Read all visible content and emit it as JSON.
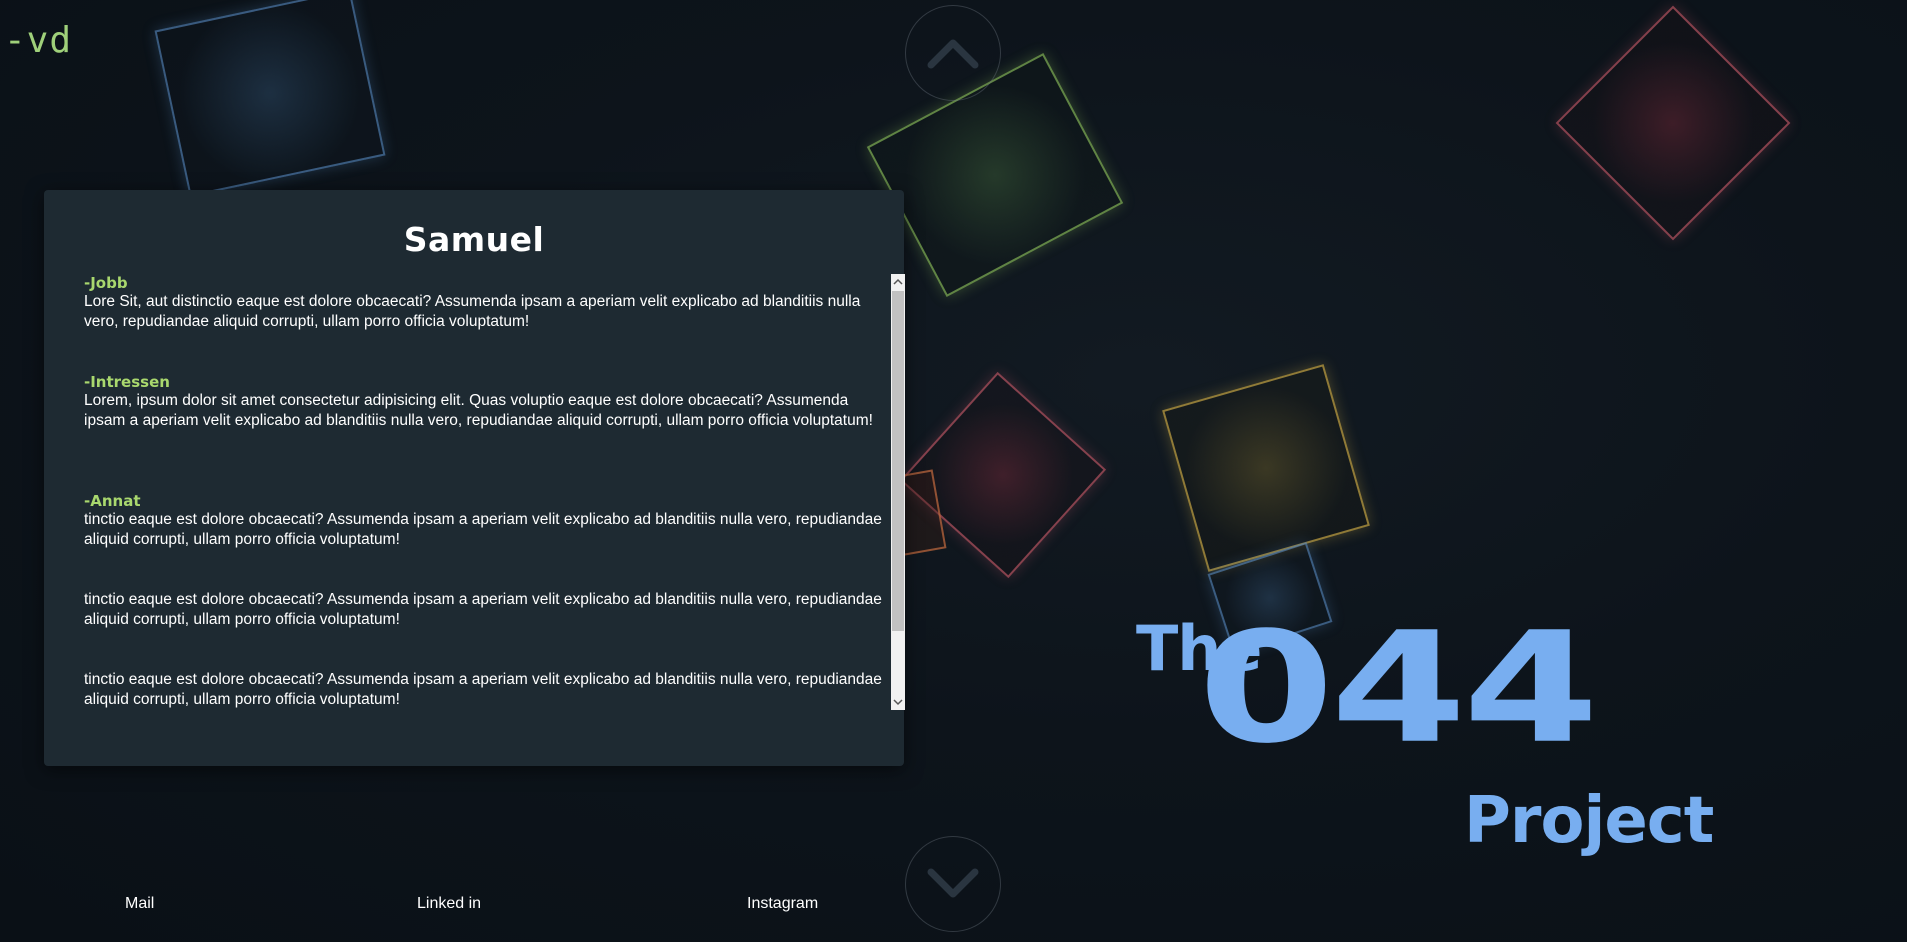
{
  "logo": {
    "text": "-vd"
  },
  "panel": {
    "title": "Samuel",
    "sections": [
      {
        "heading": "-Jobb",
        "text": "Lore Sit, aut distinctio eaque est dolore obcaecati? Assumenda ipsam a aperiam velit explicabo ad blanditiis nulla vero, repudiandae aliquid corrupti, ullam porro officia voluptatum!"
      },
      {
        "heading": "-Intressen",
        "text": "Lorem, ipsum dolor sit amet consectetur adipisicing elit. Quas voluptio eaque est dolore obcaecati? Assumenda ipsam a aperiam velit explicabo ad blanditiis nulla vero, repudiandae aliquid corrupti, ullam porro officia voluptatum!"
      },
      {
        "heading": "-Annat",
        "text": "tinctio eaque est dolore obcaecati? Assumenda ipsam a aperiam velit explicabo ad blanditiis nulla vero, repudiandae aliquid corrupti, ullam porro officia voluptatum!"
      },
      {
        "heading": "",
        "text": "tinctio eaque est dolore obcaecati? Assumenda ipsam a aperiam velit explicabo ad blanditiis nulla vero, repudiandae aliquid corrupti, ullam porro officia voluptatum!"
      },
      {
        "heading": "",
        "text": "tinctio eaque est dolore obcaecati? Assumenda ipsam a aperiam velit explicabo ad blanditiis nulla vero, repudiandae aliquid corrupti, ullam porro officia voluptatum!"
      }
    ]
  },
  "navigation": {
    "up_icon": "chevron-up-icon",
    "down_icon": "chevron-down-icon"
  },
  "brand": {
    "the": "The",
    "number": "044",
    "project": "Project"
  },
  "footer": {
    "links": [
      "Mail",
      "Linked in",
      "Instagram"
    ]
  },
  "colors": {
    "accent_green": "#a9d86e",
    "logo_green": "#9fd07a",
    "brand_blue": "#78aef0",
    "panel_bg": "#1e2a32",
    "page_bg": "#0d141b"
  }
}
